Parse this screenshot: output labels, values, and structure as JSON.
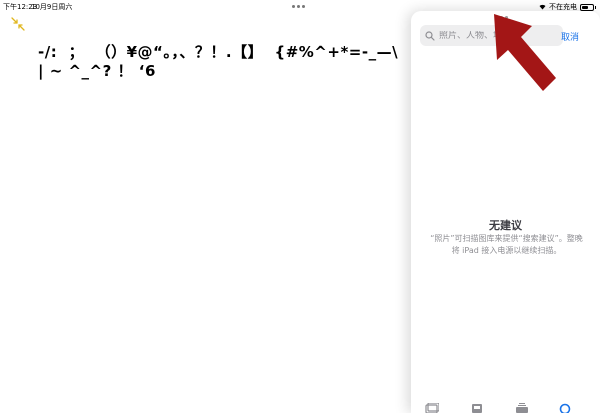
{
  "status_bar": {
    "time": "下午12:23",
    "date": "10月9日周六",
    "charging_text": "不在充电",
    "battery_level": 0.55
  },
  "document": {
    "text": "-/:  ；  （）¥@“。，、？！.【】  {#%^+*=-_—\\ | ~ ^_^? ！ ‘6"
  },
  "photos_panel": {
    "search_placeholder": "照片、人物、地点...",
    "cancel_label": "取消",
    "empty_title": "无建议",
    "empty_message": "“照片”可扫描图库来提供“搜索建议”。整晚将 iPad 接入电源以继续扫描。",
    "tabs": [
      "photos-tab-icon",
      "for-you-tab-icon",
      "albums-tab-icon",
      "search-tab-icon"
    ]
  },
  "colors": {
    "accent": "#1a73e8",
    "arrow": "#a31616",
    "collapse_icon": "#e0b61d"
  }
}
